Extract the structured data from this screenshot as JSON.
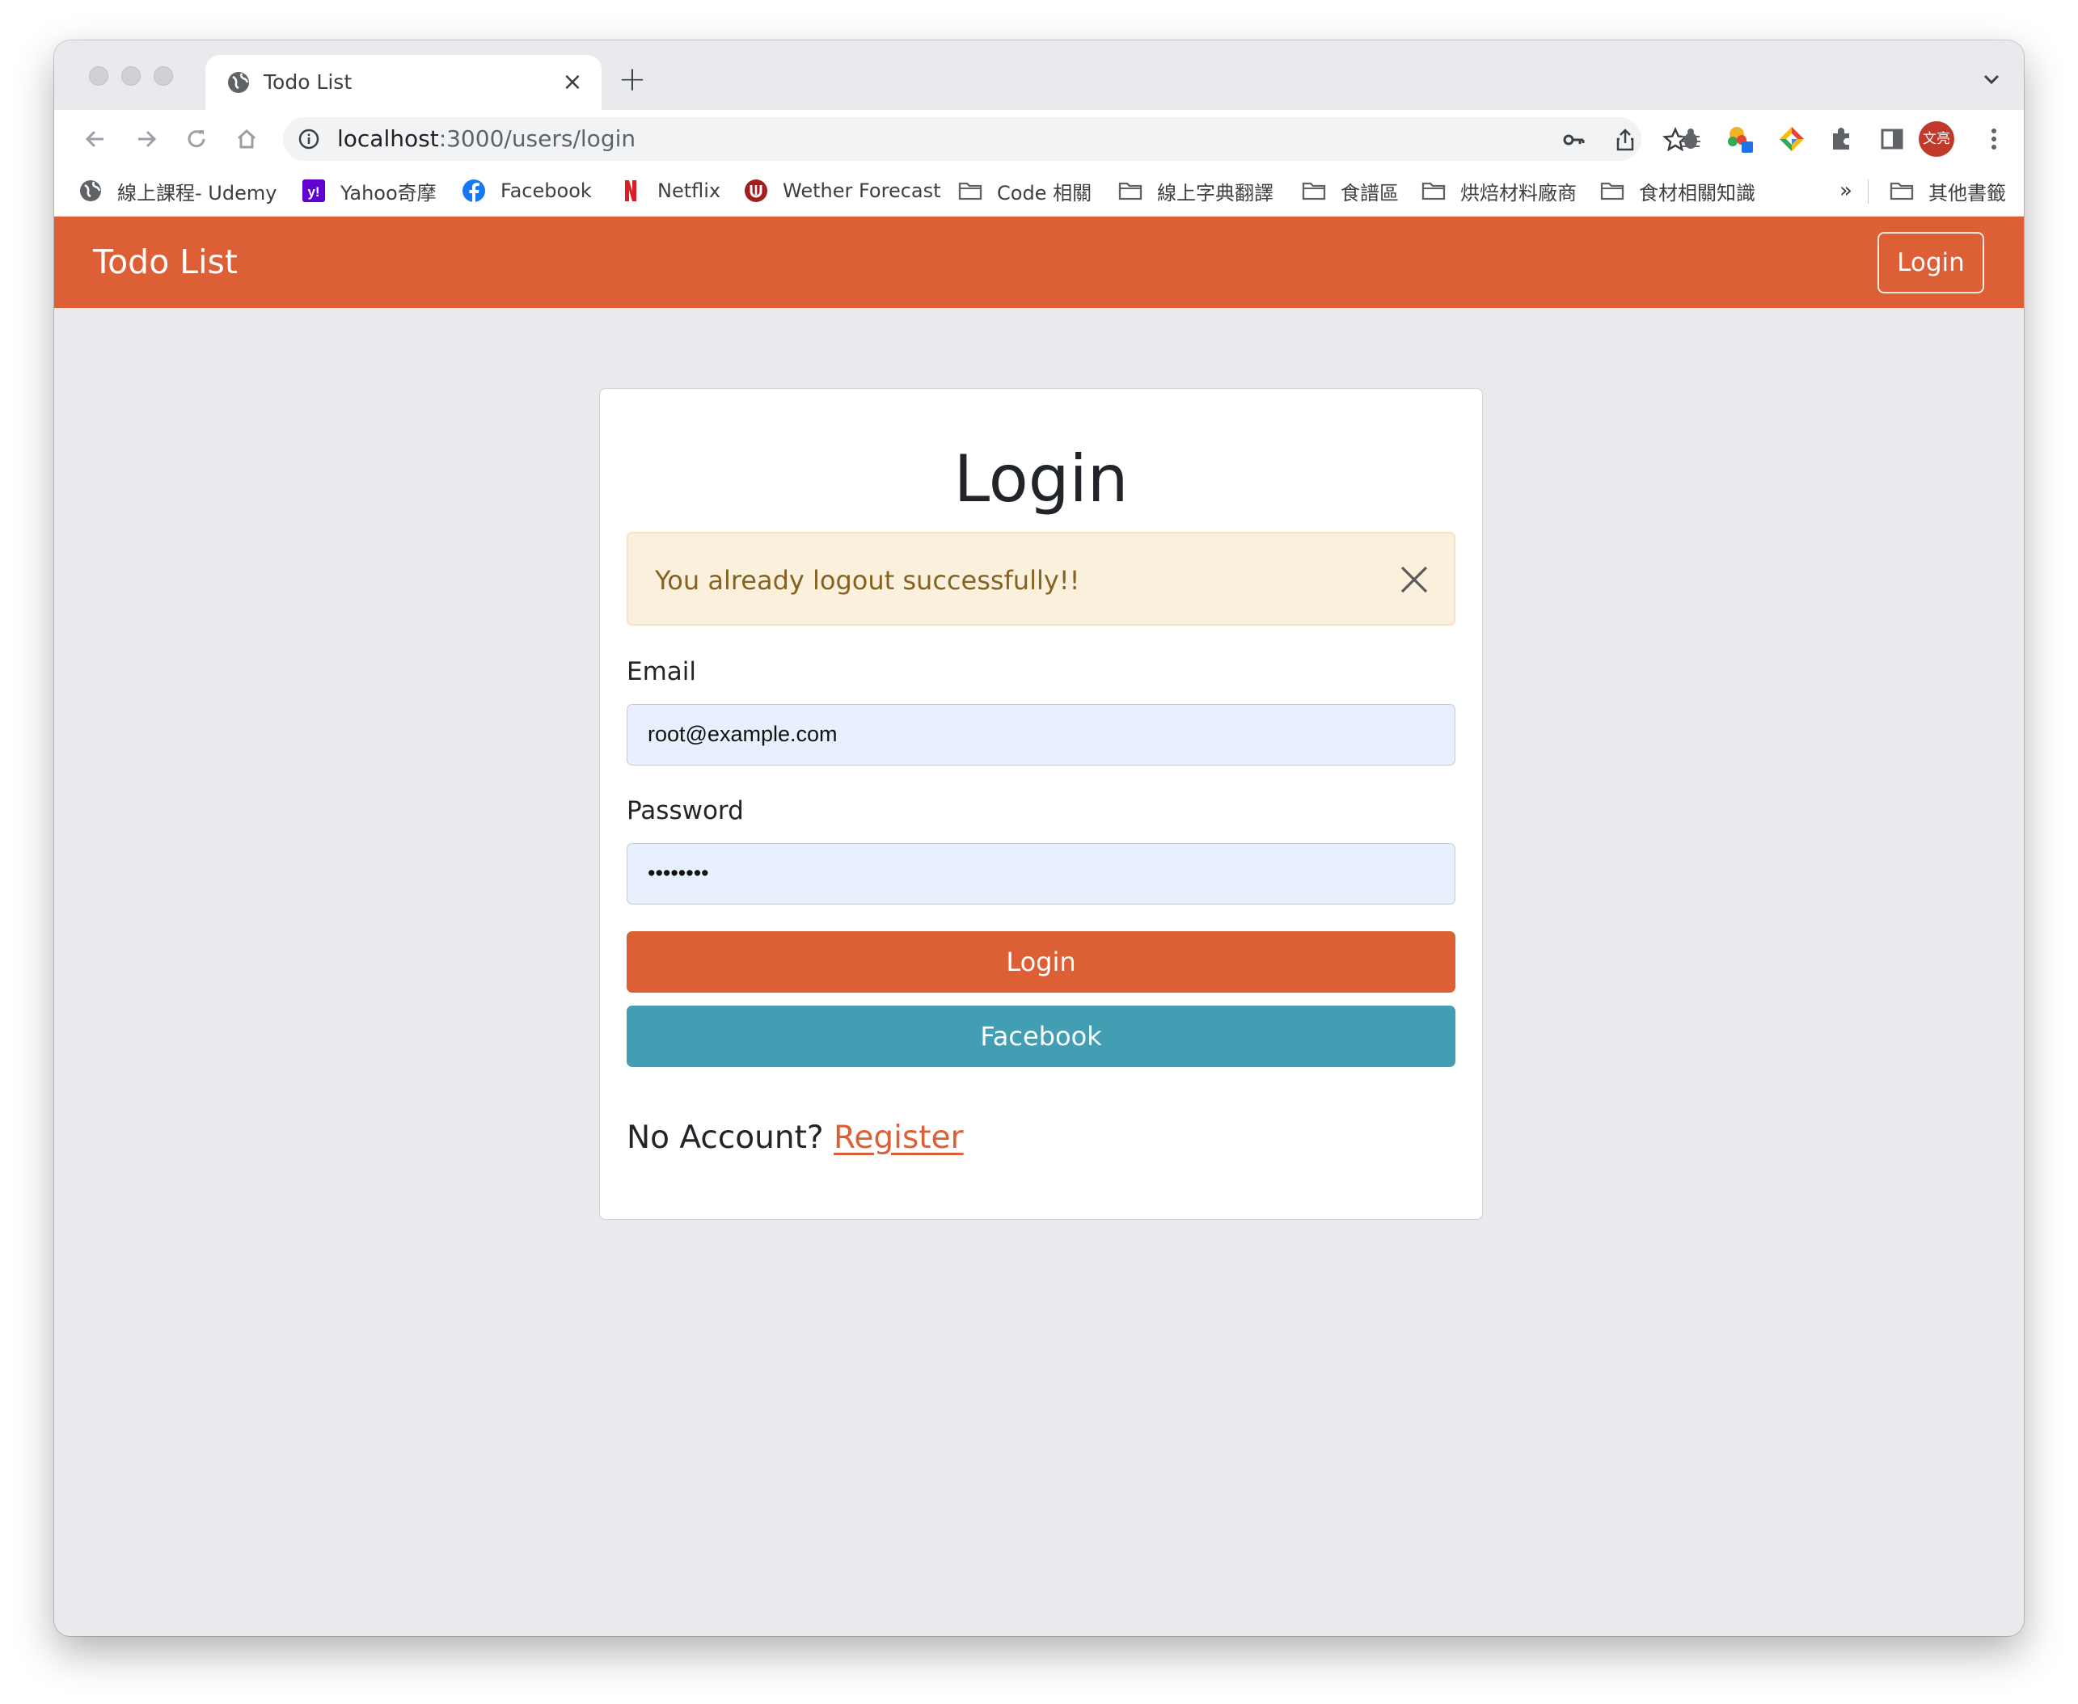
{
  "browser": {
    "tab": {
      "title": "Todo List",
      "close": "×",
      "new_tab": "+"
    },
    "address": {
      "host": "localhost",
      "path": ":3000/users/login"
    },
    "profile_avatar": "文亮",
    "bookmarks": [
      {
        "label": "線上課程- Udemy",
        "icon": "globe-icon"
      },
      {
        "label": "Yahoo奇摩",
        "icon": "yahoo-icon"
      },
      {
        "label": "Facebook",
        "icon": "facebook-icon"
      },
      {
        "label": "Netflix",
        "icon": "netflix-icon"
      },
      {
        "label": "Wether Forecast",
        "icon": "weather-icon"
      },
      {
        "label": "Code 相關",
        "icon": "folder-icon"
      },
      {
        "label": "線上字典翻譯",
        "icon": "folder-icon"
      },
      {
        "label": "食譜區",
        "icon": "folder-icon"
      },
      {
        "label": "烘焙材料廠商",
        "icon": "folder-icon"
      },
      {
        "label": "食材相關知識",
        "icon": "folder-icon"
      }
    ],
    "bookmarks_overflow": "»",
    "other_bookmarks": "其他書籤"
  },
  "navbar": {
    "brand": "Todo List",
    "login_label": "Login"
  },
  "login_card": {
    "title": "Login",
    "alert": {
      "message": "You already logout successfully!!"
    },
    "email": {
      "label": "Email",
      "value": "root@example.com"
    },
    "password": {
      "label": "Password",
      "value": "••••••••"
    },
    "login_button": "Login",
    "facebook_button": "Facebook",
    "footer": {
      "prompt": "No Account?",
      "register_link": "Register"
    }
  },
  "colors": {
    "brand": "#dd5f36",
    "facebook_button": "#429fb3",
    "alert_bg": "#faf0dc",
    "alert_text": "#866222",
    "input_bg": "#e8f0fe",
    "page_bg": "#e8eaed"
  }
}
